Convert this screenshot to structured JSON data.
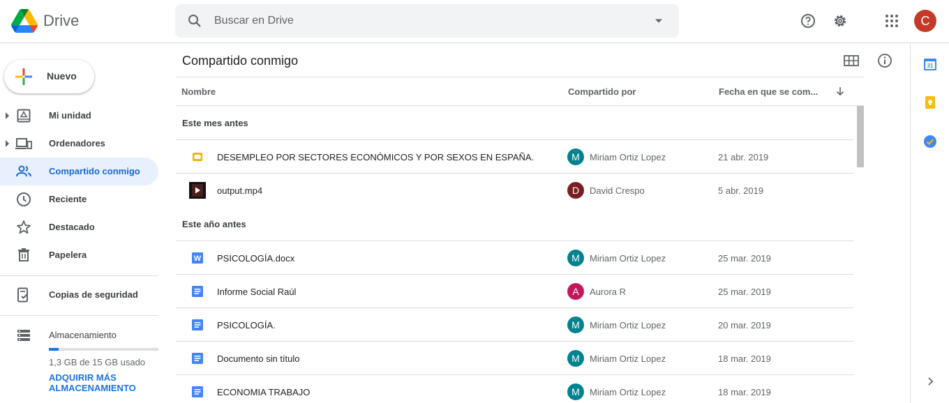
{
  "header": {
    "app_name": "Drive",
    "search_placeholder": "Buscar en Drive",
    "avatar_letter": "C",
    "avatar_color": "#c53929"
  },
  "sidebar": {
    "new_label": "Nuevo",
    "items": [
      {
        "label": "Mi unidad",
        "icon": "my-drive-icon"
      },
      {
        "label": "Ordenadores",
        "icon": "computers-icon"
      },
      {
        "label": "Compartido conmigo",
        "icon": "shared-icon",
        "active": true
      },
      {
        "label": "Reciente",
        "icon": "clock-icon"
      },
      {
        "label": "Destacado",
        "icon": "star-icon"
      },
      {
        "label": "Papelera",
        "icon": "trash-icon"
      }
    ],
    "backups_label": "Copias de seguridad",
    "storage": {
      "label": "Almacenamiento",
      "used_text": "1,3 GB de 15 GB usado",
      "used_fraction": 0.087,
      "buy_label": "ADQUIRIR MÁS ALMACENAMIENTO"
    }
  },
  "main": {
    "title": "Compartido conmigo",
    "columns": {
      "name": "Nombre",
      "shared_by": "Compartido por",
      "date": "Fecha en que se com..."
    },
    "groups": [
      {
        "label": "Este mes antes",
        "files": [
          {
            "name": "DESEMPLEO POR SECTORES ECONÓMICOS Y POR SEXOS EN ESPAÑA.",
            "type": "slides",
            "owner": "Miriam Ortiz Lopez",
            "owner_initial": "M",
            "owner_color": "#00838f",
            "date": "21 abr. 2019"
          },
          {
            "name": "output.mp4",
            "type": "video",
            "owner": "David Crespo",
            "owner_initial": "D",
            "owner_color": "#7a1f1f",
            "date": "5 abr. 2019"
          }
        ]
      },
      {
        "label": "Este año antes",
        "files": [
          {
            "name": "PSICOLOGÍA.docx",
            "type": "word",
            "owner": "Miriam Ortiz Lopez",
            "owner_initial": "M",
            "owner_color": "#00838f",
            "date": "25 mar. 2019"
          },
          {
            "name": "Informe Social Raúl",
            "type": "doc",
            "owner": "Aurora R",
            "owner_initial": "A",
            "owner_color": "#c2185b",
            "date": "25 mar. 2019"
          },
          {
            "name": "PSICOLOGÍA.",
            "type": "doc",
            "owner": "Miriam Ortiz Lopez",
            "owner_initial": "M",
            "owner_color": "#00838f",
            "date": "20 mar. 2019"
          },
          {
            "name": "Documento sin título",
            "type": "doc",
            "owner": "Miriam Ortiz Lopez",
            "owner_initial": "M",
            "owner_color": "#00838f",
            "date": "18 mar. 2019"
          },
          {
            "name": "ECONOMIA TRABAJO",
            "type": "doc",
            "owner": "Miriam Ortiz Lopez",
            "owner_initial": "M",
            "owner_color": "#00838f",
            "date": "18 mar. 2019"
          }
        ]
      }
    ]
  },
  "right_panel": {
    "calendar_day": "31",
    "icons": [
      "calendar-icon",
      "keep-icon",
      "tasks-icon",
      "chevron-right-icon"
    ]
  }
}
